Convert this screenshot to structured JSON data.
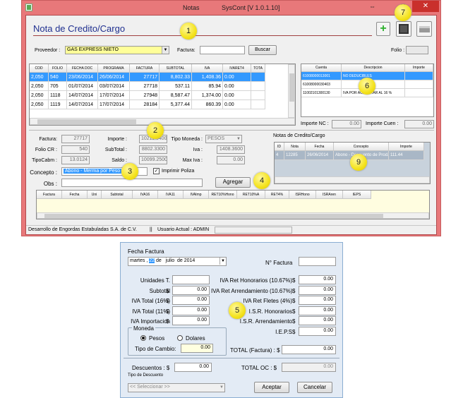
{
  "window": {
    "title": "Notas",
    "app": "SysCont [V 1.0.1.10]"
  },
  "heading": "Nota de Credito/Cargo",
  "filters": {
    "proveedor_label": "Proveedor :",
    "proveedor_value": "GAS EXPRESS NIETO",
    "factura_label": "Factura:",
    "factura_value": "",
    "buscar": "Buscar",
    "folio_label": "Folio :",
    "folio_value": ""
  },
  "facturas": {
    "columns": [
      "COD",
      "FOLIO",
      "FECHA DOC",
      "PROGRAMA",
      "FACTURA",
      "SUBTOTAL",
      "IVA",
      "IVARET4",
      "TOTA"
    ],
    "rows": [
      [
        "2,050",
        "540",
        "23/06/2014",
        "26/06/2014",
        "27717",
        "8,802.33",
        "1,408.36",
        "0.00",
        ""
      ],
      [
        "2,050",
        "705",
        "01/07/2014",
        "03/07/2014",
        "27718",
        "537.11",
        "85.94",
        "0.00",
        ""
      ],
      [
        "2,050",
        "1118",
        "14/07/2014",
        "17/07/2014",
        "27948",
        "8,587.47",
        "1,374.00",
        "0.00",
        ""
      ],
      [
        "2,050",
        "1119",
        "14/07/2014",
        "17/07/2014",
        "28184",
        "5,377.44",
        "860.39",
        "0.00",
        ""
      ]
    ]
  },
  "cuentas": {
    "columns": [
      "Cuenta",
      "Descripcion",
      "Importe"
    ],
    "rows": [
      [
        "61008000013001",
        "NO DEDUCIBLES",
        ""
      ],
      [
        "61008000030403",
        "",
        ""
      ],
      [
        "11002101300130",
        "IVA POR ACREDITAR AL 16 %",
        ""
      ]
    ],
    "importe_nc_label": "Importe NC :",
    "importe_nc": "0.00",
    "importe_cuen_label": "Importe Cuen :",
    "importe_cuen": "0.00"
  },
  "detalle": {
    "factura_label": "Factura:",
    "factura": "27717",
    "importe_label": "Importe :",
    "importe": "10211.0400",
    "folio_cr_label": "Folio CR :",
    "folio_cr": "540",
    "subtotal_label": "SubTotal :",
    "subtotal": "8802.3300",
    "tipocabm_label": "TipoCabm :",
    "tipocabm": "13.0124",
    "saldo_label": "Saldo :",
    "saldo": "10099.2500",
    "tipo_moneda_label": "Tipo Moneda :",
    "tipo_moneda": "PESOS",
    "iva_label": "Iva :",
    "iva": "1408.3600",
    "max_iva_label": "Max Iva :",
    "max_iva": "0.00",
    "concepto_label": "Concepto :",
    "concepto": "Abono - Merma por Peso",
    "imprimir_poliza": "Imprimir Poliza",
    "obs_label": "Obs :",
    "obs": "",
    "agregar": "Agregar"
  },
  "notas": {
    "title": "Notas de Credito/Cargo",
    "columns": [
      "ID",
      "Nota",
      "Fecha",
      "Concepto",
      "Importe"
    ],
    "rows": [
      [
        "4",
        "12285",
        "26/06/2014",
        "Abono - Descuento de Prod...",
        "111.44"
      ]
    ]
  },
  "lineas": {
    "columns": [
      "Factura",
      "Fecha",
      "Uni",
      "Subtotal",
      "IVA16",
      "IVA11",
      "IVAImp",
      "RET10%Hono",
      "RET10%A",
      "RET4%",
      "ISRHono",
      "ISRAren",
      "IEPS"
    ]
  },
  "status": {
    "empresa": "Desarrollo de Engordas Estabuladas S.A. de C.V.",
    "sep": "||",
    "usuario": "Usuario Actual : ADMIN"
  },
  "form": {
    "fecha_label": "Fecha Factura",
    "fecha_dia": "martes",
    "fecha_num": "22",
    "fecha_de": "de",
    "fecha_mes": "julio",
    "fecha_anio": "de 2014",
    "n_factura_label": "N° Factura",
    "n_factura": "",
    "left": [
      {
        "label": "Unidades T.",
        "sym": "",
        "value": ""
      },
      {
        "label": "Subtotal",
        "sym": "$",
        "value": "0.00"
      },
      {
        "label": "IVA Total (16%)",
        "sym": "$",
        "value": "0.00"
      },
      {
        "label": "IVA Total (11%)",
        "sym": "$",
        "value": "0.00"
      },
      {
        "label": "IVA Importacion",
        "sym": "$",
        "value": "0.00"
      }
    ],
    "right": [
      {
        "label": "IVA Ret Honorarios (10.67%)",
        "sym": "$",
        "value": "0.00"
      },
      {
        "label": "IVA Ret Arrendamiento (10.67%)",
        "sym": "$",
        "value": "0.00"
      },
      {
        "label": "IVA Ret Fletes (4%)",
        "sym": "$",
        "value": "0.00"
      },
      {
        "label": "I.S.R. Honorarios",
        "sym": "$",
        "value": "0.00"
      },
      {
        "label": "I.S.R. Arrendamiento",
        "sym": "$",
        "value": "0.00"
      },
      {
        "label": "I.E.P.S",
        "sym": "$",
        "value": "0.00"
      }
    ],
    "moneda_label": "Moneda",
    "pesos": "Pesos",
    "dolares": "Dolares",
    "tipo_cambio_label": "Tipo de Cambio:",
    "tipo_cambio": "0.00",
    "total_factura_label": "TOTAL (Factura) : $",
    "total_factura": "0.00",
    "descuentos_label": "Descuentos : $",
    "descuentos": "0.00",
    "total_oc_label": "TOTAL OC : $",
    "total_oc": "0.00",
    "tipo_descuento_label": "Tipo de Descuento",
    "tipo_descuento": "<< Seleccionar >>",
    "aceptar": "Aceptar",
    "cancelar": "Cancelar"
  },
  "badges": [
    "1",
    "2",
    "3",
    "4",
    "5",
    "6",
    "7",
    "9"
  ],
  "colors": {
    "frame": "#e8787a",
    "selected": "#3399ff",
    "badge": "#f4e21b"
  }
}
